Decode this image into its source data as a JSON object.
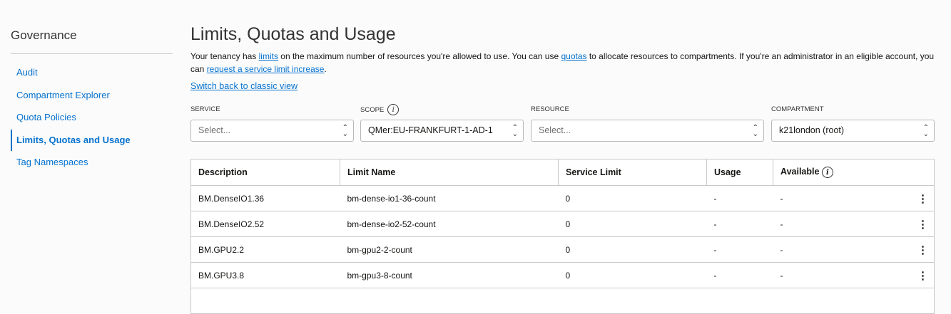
{
  "sidebar": {
    "title": "Governance",
    "items": [
      {
        "label": "Audit"
      },
      {
        "label": "Compartment Explorer"
      },
      {
        "label": "Quota Policies"
      },
      {
        "label": "Limits, Quotas and Usage"
      },
      {
        "label": "Tag Namespaces"
      }
    ]
  },
  "page": {
    "title": "Limits, Quotas and Usage",
    "desc_1": "Your tenancy has ",
    "link_limits": "limits",
    "desc_2": " on the maximum number of resources you're allowed to use. You can use ",
    "link_quotas": "quotas",
    "desc_3": " to allocate resources to compartments. If you're an administrator in an eligible account, you can ",
    "link_request": "request a service limit increase",
    "desc_4": ".",
    "switch_link": "Switch back to classic view"
  },
  "filters": {
    "service": {
      "label": "SERVICE",
      "value": "Select..."
    },
    "scope": {
      "label": "SCOPE",
      "value": "QMer:EU-FRANKFURT-1-AD-1"
    },
    "resource": {
      "label": "RESOURCE",
      "value": "Select..."
    },
    "compartment": {
      "label": "COMPARTMENT",
      "value": "k21london (root)"
    }
  },
  "table": {
    "headers": [
      "Description",
      "Limit Name",
      "Service Limit",
      "Usage",
      "Available"
    ],
    "rows": [
      {
        "description": "BM.DenseIO1.36",
        "limit_name": "bm-dense-io1-36-count",
        "service_limit": "0",
        "usage": "-",
        "available": "-"
      },
      {
        "description": "BM.DenseIO2.52",
        "limit_name": "bm-dense-io2-52-count",
        "service_limit": "0",
        "usage": "-",
        "available": "-"
      },
      {
        "description": "BM.GPU2.2",
        "limit_name": "bm-gpu2-2-count",
        "service_limit": "0",
        "usage": "-",
        "available": "-"
      },
      {
        "description": "BM.GPU3.8",
        "limit_name": "bm-gpu3-8-count",
        "service_limit": "0",
        "usage": "-",
        "available": "-"
      }
    ]
  }
}
